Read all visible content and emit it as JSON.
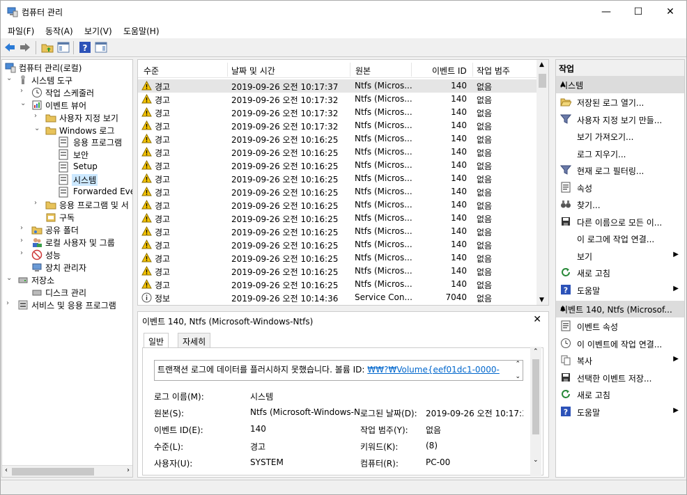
{
  "window": {
    "title": "컴퓨터 관리",
    "minimize_glyph": "—",
    "maximize_glyph": "☐",
    "close_glyph": "✕"
  },
  "menu": [
    "파일(F)",
    "동작(A)",
    "보기(V)",
    "도움말(H)"
  ],
  "tree": {
    "root": "컴퓨터 관리(로컬)",
    "system_tools": "시스템 도구",
    "task_scheduler": "작업 스케줄러",
    "event_viewer": "이벤트 뷰어",
    "custom_views": "사용자 지정 보기",
    "windows_logs": "Windows 로그",
    "application": "응용 프로그램",
    "security": "보안",
    "setup": "Setup",
    "system": "시스템",
    "forwarded": "Forwarded Even",
    "app_services": "응용 프로그램 및 서",
    "subscriptions": "구독",
    "shared_folders": "공유 폴더",
    "local_users": "로컬 사용자 및 그룹",
    "performance": "성능",
    "device_manager": "장치 관리자",
    "storage": "저장소",
    "disk_management": "디스크 관리",
    "services_apps": "서비스 및 응용 프로그램"
  },
  "list": {
    "columns": [
      "수준",
      "날짜 및 시간",
      "원본",
      "이벤트 ID",
      "작업 범주"
    ],
    "rows": [
      {
        "level": "경고",
        "datetime": "2019-09-26 오전 10:17:37",
        "source": "Ntfs (Micros...",
        "id": "140",
        "category": "없음",
        "type": "warning"
      },
      {
        "level": "경고",
        "datetime": "2019-09-26 오전 10:17:32",
        "source": "Ntfs (Micros...",
        "id": "140",
        "category": "없음",
        "type": "warning"
      },
      {
        "level": "경고",
        "datetime": "2019-09-26 오전 10:17:32",
        "source": "Ntfs (Micros...",
        "id": "140",
        "category": "없음",
        "type": "warning"
      },
      {
        "level": "경고",
        "datetime": "2019-09-26 오전 10:17:32",
        "source": "Ntfs (Micros...",
        "id": "140",
        "category": "없음",
        "type": "warning"
      },
      {
        "level": "경고",
        "datetime": "2019-09-26 오전 10:16:25",
        "source": "Ntfs (Micros...",
        "id": "140",
        "category": "없음",
        "type": "warning"
      },
      {
        "level": "경고",
        "datetime": "2019-09-26 오전 10:16:25",
        "source": "Ntfs (Micros...",
        "id": "140",
        "category": "없음",
        "type": "warning"
      },
      {
        "level": "경고",
        "datetime": "2019-09-26 오전 10:16:25",
        "source": "Ntfs (Micros...",
        "id": "140",
        "category": "없음",
        "type": "warning"
      },
      {
        "level": "경고",
        "datetime": "2019-09-26 오전 10:16:25",
        "source": "Ntfs (Micros...",
        "id": "140",
        "category": "없음",
        "type": "warning"
      },
      {
        "level": "경고",
        "datetime": "2019-09-26 오전 10:16:25",
        "source": "Ntfs (Micros...",
        "id": "140",
        "category": "없음",
        "type": "warning"
      },
      {
        "level": "경고",
        "datetime": "2019-09-26 오전 10:16:25",
        "source": "Ntfs (Micros...",
        "id": "140",
        "category": "없음",
        "type": "warning"
      },
      {
        "level": "경고",
        "datetime": "2019-09-26 오전 10:16:25",
        "source": "Ntfs (Micros...",
        "id": "140",
        "category": "없음",
        "type": "warning"
      },
      {
        "level": "경고",
        "datetime": "2019-09-26 오전 10:16:25",
        "source": "Ntfs (Micros...",
        "id": "140",
        "category": "없음",
        "type": "warning"
      },
      {
        "level": "경고",
        "datetime": "2019-09-26 오전 10:16:25",
        "source": "Ntfs (Micros...",
        "id": "140",
        "category": "없음",
        "type": "warning"
      },
      {
        "level": "경고",
        "datetime": "2019-09-26 오전 10:16:25",
        "source": "Ntfs (Micros...",
        "id": "140",
        "category": "없음",
        "type": "warning"
      },
      {
        "level": "경고",
        "datetime": "2019-09-26 오전 10:16:25",
        "source": "Ntfs (Micros...",
        "id": "140",
        "category": "없음",
        "type": "warning"
      },
      {
        "level": "경고",
        "datetime": "2019-09-26 오전 10:16:25",
        "source": "Ntfs (Micros...",
        "id": "140",
        "category": "없음",
        "type": "warning"
      },
      {
        "level": "정보",
        "datetime": "2019-09-26 오전 10:14:36",
        "source": "Service Con...",
        "id": "7040",
        "category": "없음",
        "type": "info"
      }
    ]
  },
  "detail": {
    "title": "이벤트 140, Ntfs (Microsoft-Windows-Ntfs)",
    "close_glyph": "✕",
    "tab_general": "일반",
    "tab_details": "자세히",
    "message": "트랜잭션 로그에 데이터를 플러시하지 못했습니다. 볼륨 ID: ",
    "message_link": "₩₩?₩Volume{eef01dc1-0000-",
    "labels": {
      "log_name": "로그 이름(M):",
      "source": "원본(S):",
      "event_id": "이벤트 ID(E):",
      "level": "수준(L):",
      "user": "사용자(U):",
      "logged": "로그된 날짜(D):",
      "task_category": "작업 범주(Y):",
      "keywords": "키워드(K):",
      "computer": "컴퓨터(R):"
    },
    "values": {
      "log_name": "시스템",
      "source": "Ntfs (Microsoft-Windows-N",
      "event_id": "140",
      "level": "경고",
      "user": "SYSTEM",
      "logged": "2019-09-26 오전 10:17:3",
      "task_category": "없음",
      "keywords": "(8)",
      "computer": "PC-00"
    }
  },
  "actions": {
    "header": "작업",
    "section_system": "시스템",
    "system_items": [
      {
        "label": "저장된 로그 열기...",
        "icon": "folder-open-icon",
        "submenu": false
      },
      {
        "label": "사용자 지정 보기 만들...",
        "icon": "filter-icon",
        "submenu": false
      },
      {
        "label": "보기 가져오기...",
        "icon": "",
        "submenu": false
      },
      {
        "label": "로그 지우기...",
        "icon": "",
        "submenu": false
      },
      {
        "label": "현재 로그 필터링...",
        "icon": "filter-icon",
        "submenu": false
      },
      {
        "label": "속성",
        "icon": "properties-icon",
        "submenu": false
      },
      {
        "label": "찾기...",
        "icon": "binoculars-icon",
        "submenu": false
      },
      {
        "label": "다른 이름으로 모든 이...",
        "icon": "save-icon",
        "submenu": false
      },
      {
        "label": "이 로그에 작업 연결...",
        "icon": "",
        "submenu": false
      },
      {
        "label": "보기",
        "icon": "",
        "submenu": true
      },
      {
        "label": "새로 고침",
        "icon": "refresh-icon",
        "submenu": false
      },
      {
        "label": "도움말",
        "icon": "help-icon",
        "submenu": true
      }
    ],
    "section_event": "이벤트 140, Ntfs (Microsof...",
    "event_items": [
      {
        "label": "이벤트 속성",
        "icon": "properties-icon",
        "submenu": false
      },
      {
        "label": "이 이벤트에 작업 연결...",
        "icon": "clock-icon",
        "submenu": false
      },
      {
        "label": "복사",
        "icon": "copy-icon",
        "submenu": true
      },
      {
        "label": "선택한 이벤트 저장...",
        "icon": "save-icon",
        "submenu": false
      },
      {
        "label": "새로 고침",
        "icon": "refresh-icon",
        "submenu": false
      },
      {
        "label": "도움말",
        "icon": "help-icon",
        "submenu": true
      }
    ]
  },
  "colors": {
    "selection": "#cce8ff",
    "section_header": "#dcdcdc",
    "link": "#0066cc",
    "warning_fill": "#f5c400"
  }
}
